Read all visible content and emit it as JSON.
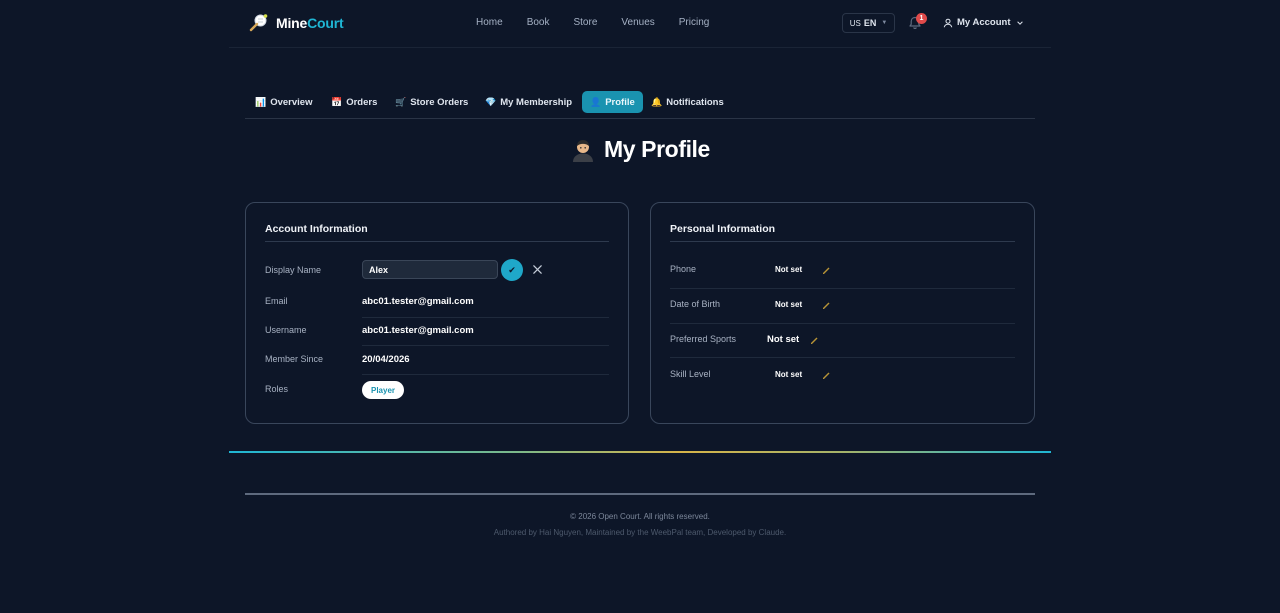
{
  "header": {
    "logo_part1": "Mine",
    "logo_part2": "Court",
    "nav": [
      "Home",
      "Book",
      "Store",
      "Venues",
      "Pricing"
    ],
    "lang_flag": "US",
    "lang_code": "EN",
    "notification_count": "1",
    "account_label": "My Account"
  },
  "tabs": [
    {
      "icon": "📊",
      "label": "Overview"
    },
    {
      "icon": "📅",
      "label": "Orders"
    },
    {
      "icon": "🛒",
      "label": "Store Orders"
    },
    {
      "icon": "💎",
      "label": "My Membership"
    },
    {
      "icon": "👤",
      "label": "Profile"
    },
    {
      "icon": "🔔",
      "label": "Notifications"
    }
  ],
  "page_title": "My Profile",
  "account": {
    "title": "Account Information",
    "display_name_label": "Display Name",
    "display_name_value": "Alex",
    "email_label": "Email",
    "email_value": "abc01.tester@gmail.com",
    "username_label": "Username",
    "username_value": "abc01.tester@gmail.com",
    "member_since_label": "Member Since",
    "member_since_value": "20/04/2026",
    "roles_label": "Roles",
    "role": "Player"
  },
  "personal": {
    "title": "Personal Information",
    "phone_label": "Phone",
    "phone_value": "Not set",
    "dob_label": "Date of Birth",
    "dob_value": "Not set",
    "sports_label": "Preferred Sports",
    "sports_value": "Not set",
    "skill_label": "Skill Level",
    "skill_value": "Not set"
  },
  "footer": {
    "copyright": "© 2026 Open Court. All rights reserved.",
    "authored": "Authored by Hai Nguyen, Maintained by the WeebPal team, Developed by Claude."
  },
  "colors": {
    "background": "#0d1628",
    "accent": "#1fb6d4",
    "active_tab": "#1a93b0",
    "badge": "#e04a4a"
  }
}
